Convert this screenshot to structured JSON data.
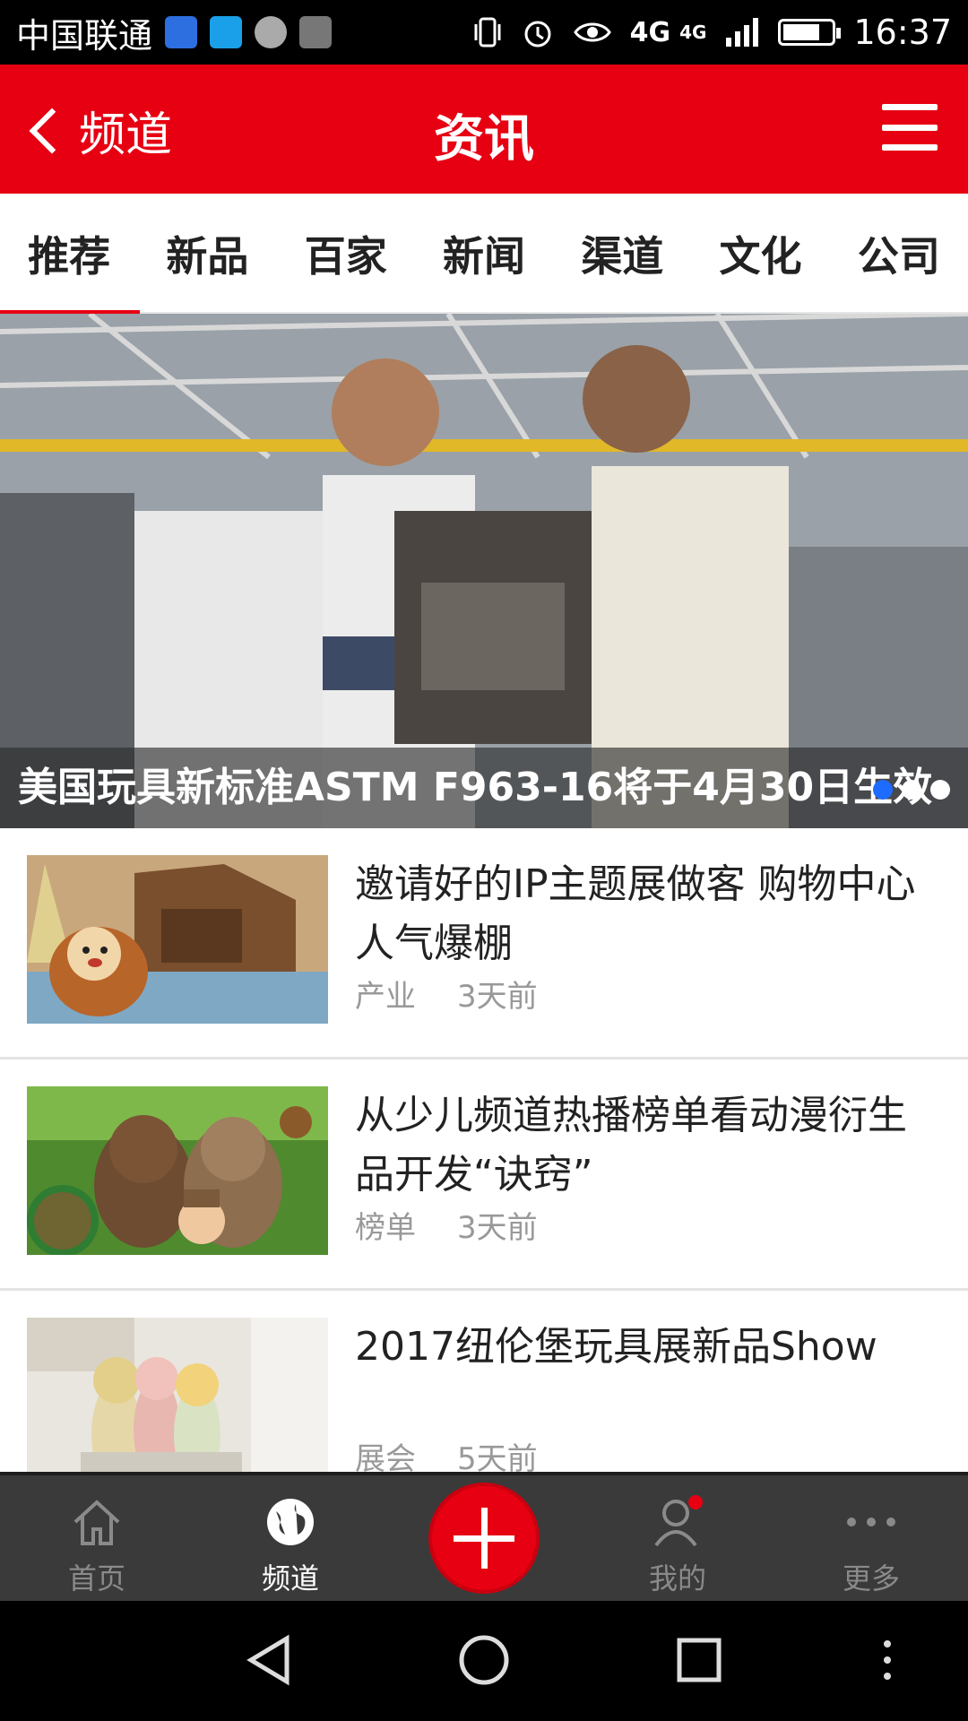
{
  "status_bar": {
    "carrier": "中国联通",
    "network": "4G",
    "network_small": "4G",
    "time": "16:37"
  },
  "header": {
    "back_label": "频道",
    "title": "资讯"
  },
  "tabs": [
    "推荐",
    "新品",
    "百家",
    "新闻",
    "渠道",
    "文化",
    "公司"
  ],
  "active_tab": "推荐",
  "banner": {
    "caption": "美国玩具新标准ASTM F963-16将于4月30日生效"
  },
  "news": [
    {
      "title": "邀请好的IP主题展做客 购物中心人气爆棚",
      "category": "产业",
      "time": "3天前"
    },
    {
      "title": "从少儿频道热播榜单看动漫衍生品开发“诀窍”",
      "category": "榜单",
      "time": "3天前"
    },
    {
      "title": "2017纽伦堡玩具展新品Show",
      "category": "展会",
      "time": "5天前"
    }
  ],
  "bottom_nav": {
    "home": "首页",
    "channel": "频道",
    "mine": "我的",
    "more": "更多"
  },
  "colors": {
    "brand_red": "#e60012",
    "dot_active": "#1e6cff"
  }
}
